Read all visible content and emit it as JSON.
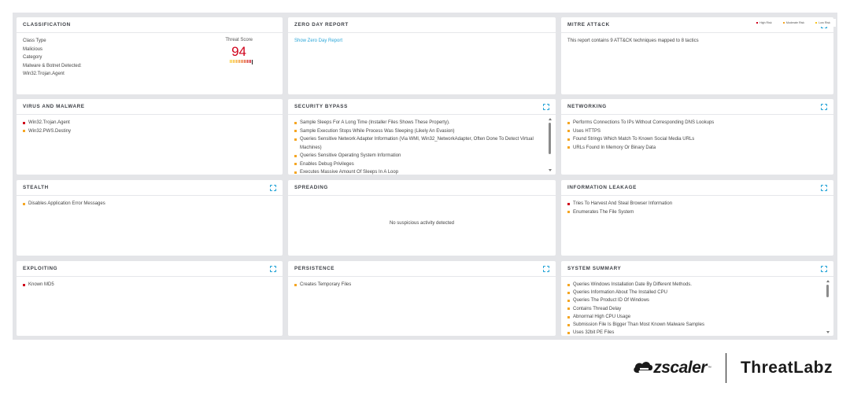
{
  "legend": [
    {
      "label": "High Risk",
      "color": "#d0021b"
    },
    {
      "label": "Moderate Risk",
      "color": "#f5a623"
    },
    {
      "label": "Low Risk",
      "color": "#f8c41c"
    }
  ],
  "classification": {
    "title": "CLASSIFICATION",
    "class_type_label": "Class Type",
    "class_type_value": "Malicious",
    "category_label": "Category",
    "category_value": "Malware & Botnet Detected:",
    "threat_name": "Win32.Trojan.Agent",
    "threat_score_label": "Threat Score",
    "threat_score": "94"
  },
  "zero_day": {
    "title": "ZERO DAY REPORT",
    "link": "Show Zero Day Report"
  },
  "mitre": {
    "title": "MITRE ATT&CK",
    "text": "This report contains 9 ATT&CK techniques mapped to 8 tactics"
  },
  "virus": {
    "title": "VIRUS AND MALWARE",
    "items": [
      {
        "text": "Win32.Trojan.Agent",
        "risk": "high"
      },
      {
        "text": "Win32.PWS.Destiny",
        "risk": "mod"
      }
    ]
  },
  "security_bypass": {
    "title": "SECURITY BYPASS",
    "items": [
      {
        "text": "Sample Sleeps For A Long Time (Installer Files Shows These Property).",
        "risk": "mod"
      },
      {
        "text": "Sample Execution Stops While Process Was Sleeping (Likely An Evasion)",
        "risk": "mod"
      },
      {
        "text": "Queries Sensitive Network Adapter Information (Via WMI, Win32_NetworkAdapter, Often Done To Detect Virtual Machines)",
        "risk": "mod"
      },
      {
        "text": "Queries Sensitive Operating System Information",
        "risk": "mod"
      },
      {
        "text": "Enables Debug Privileges",
        "risk": "mod"
      },
      {
        "text": "Executes Massive Amount Of Sleeps In A Loop",
        "risk": "mod"
      }
    ]
  },
  "networking": {
    "title": "NETWORKING",
    "items": [
      {
        "text": "Performs Connections To IPs Without Corresponding DNS Lookups",
        "risk": "mod"
      },
      {
        "text": "Uses HTTPS",
        "risk": "mod"
      },
      {
        "text": "Found Strings Which Match To Known Social Media URLs",
        "risk": "mod"
      },
      {
        "text": "URLs Found In Memory Or Binary Data",
        "risk": "mod"
      }
    ]
  },
  "stealth": {
    "title": "STEALTH",
    "items": [
      {
        "text": "Disables Application Error Messages",
        "risk": "mod"
      }
    ]
  },
  "spreading": {
    "title": "SPREADING",
    "message": "No suspicious activity detected"
  },
  "info_leak": {
    "title": "INFORMATION LEAKAGE",
    "items": [
      {
        "text": "Tries To Harvest And Steal Browser Information",
        "risk": "high"
      },
      {
        "text": "Enumerates The File System",
        "risk": "mod"
      }
    ]
  },
  "exploiting": {
    "title": "EXPLOITING",
    "items": [
      {
        "text": "Known MD5",
        "risk": "high"
      }
    ]
  },
  "persistence": {
    "title": "PERSISTENCE",
    "items": [
      {
        "text": "Creates Temporary Files",
        "risk": "mod"
      }
    ]
  },
  "system_summary": {
    "title": "SYSTEM SUMMARY",
    "items": [
      {
        "text": "Queries Windows Installation Date By Different Methods.",
        "risk": "mod"
      },
      {
        "text": "Queries Information About The Installed CPU",
        "risk": "mod"
      },
      {
        "text": "Queries The Product ID Of Windows",
        "risk": "mod"
      },
      {
        "text": "Contains Thread Delay",
        "risk": "mod"
      },
      {
        "text": "Abnormal High CPU Usage",
        "risk": "mod"
      },
      {
        "text": "Submission File Is Bigger Than Most Known Malware Samples",
        "risk": "mod"
      },
      {
        "text": "Uses 32bit PE Files",
        "risk": "mod"
      }
    ]
  },
  "footer": {
    "zscaler": "zscaler",
    "tm": "™",
    "threatlabz": "ThreatLabz"
  }
}
